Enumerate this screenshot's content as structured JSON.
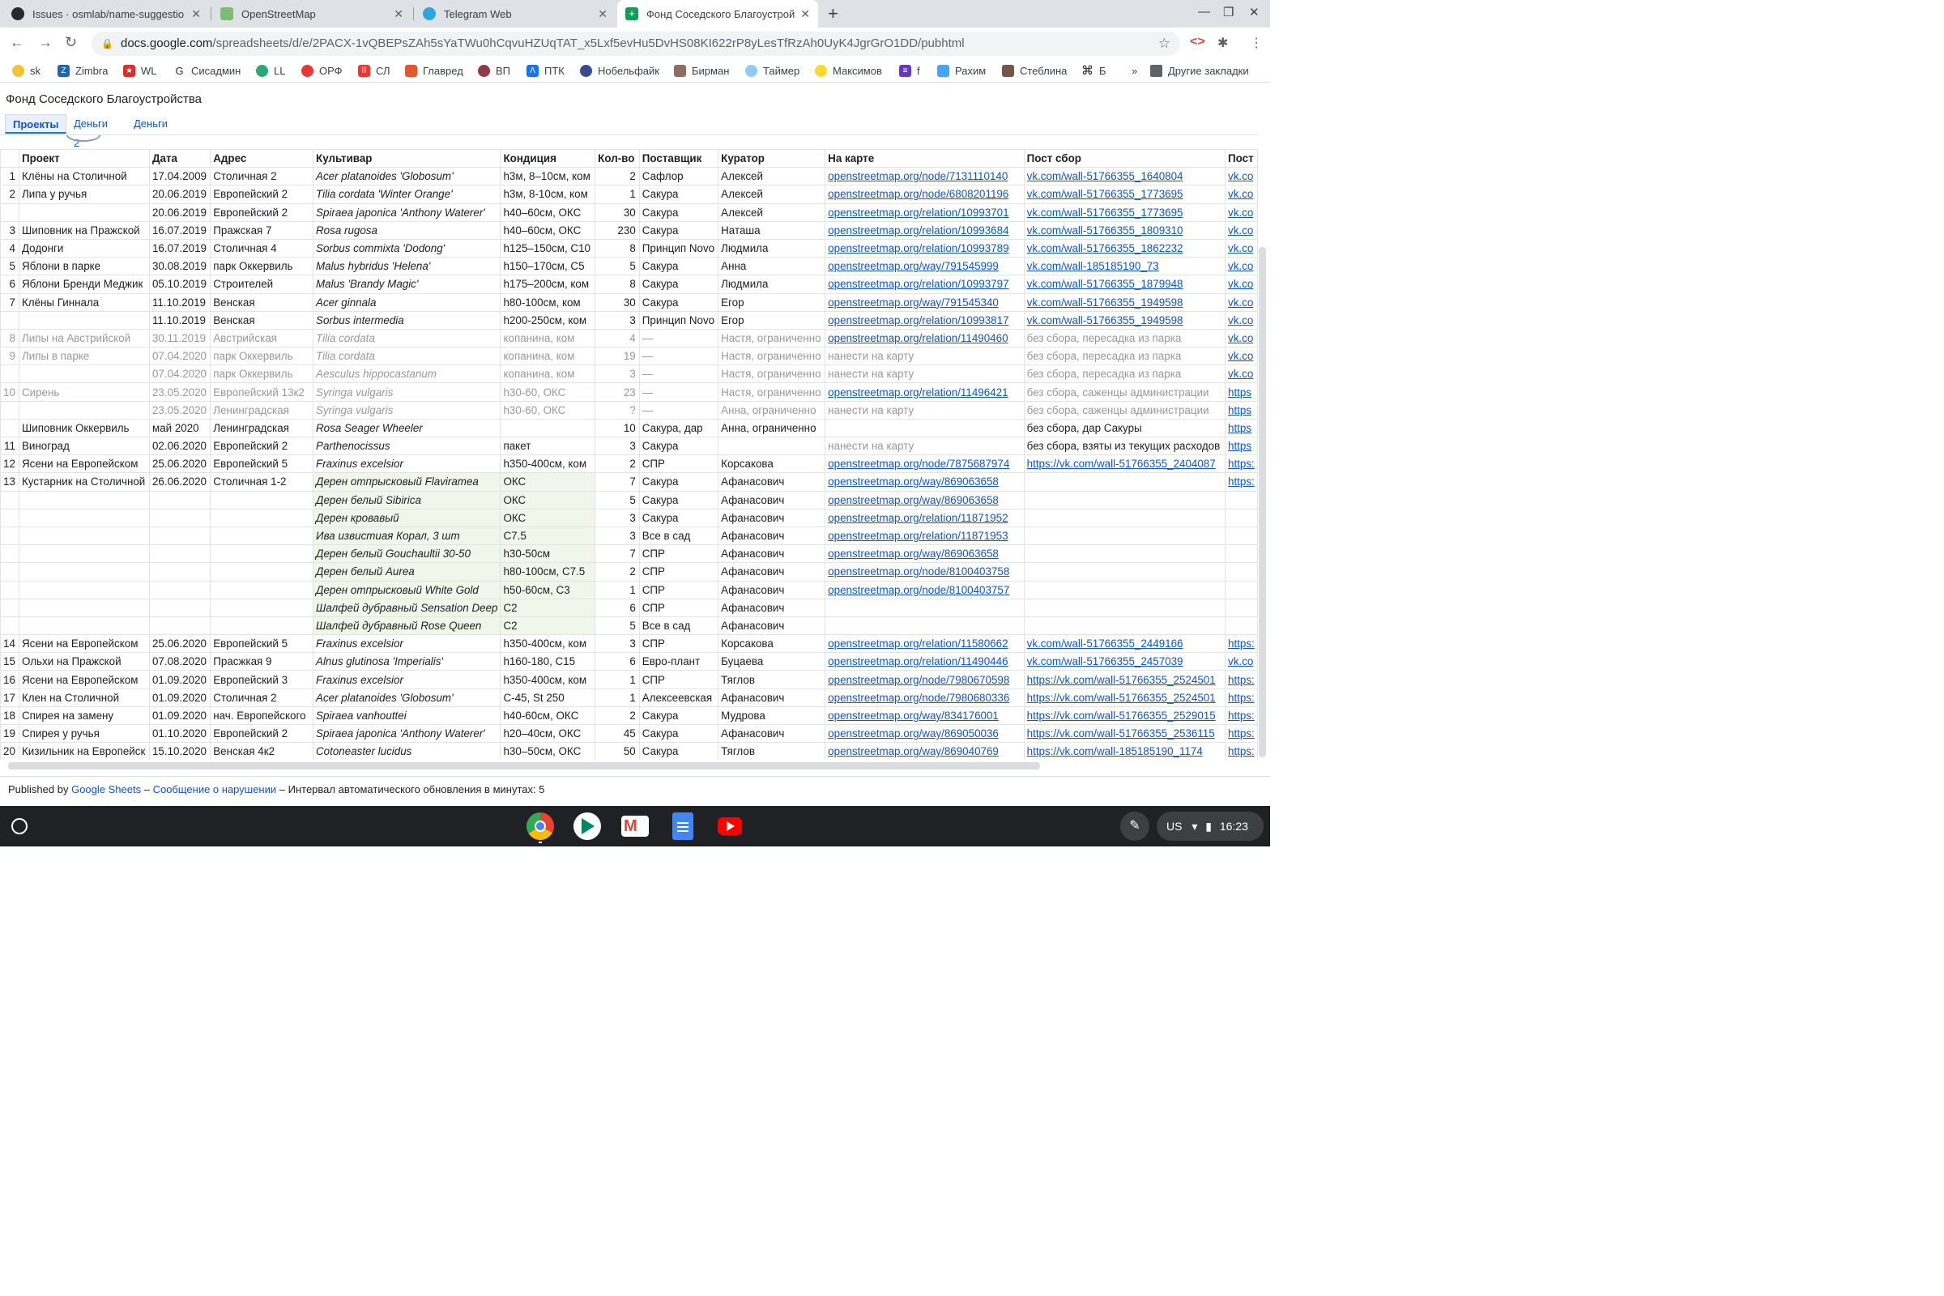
{
  "browser": {
    "tabs": [
      {
        "title": "Issues · osmlab/name-suggestio",
        "icon": "github-icon",
        "active": false
      },
      {
        "title": "OpenStreetMap",
        "icon": "osm-icon",
        "active": false
      },
      {
        "title": "Telegram Web",
        "icon": "telegram-icon",
        "active": false
      },
      {
        "title": "Фонд Соседского Благоустрой",
        "icon": "sheets-icon",
        "active": true
      }
    ],
    "new_tab": "+",
    "url_host": "docs.google.com",
    "url_path": "/spreadsheets/d/e/2PACX-1vQBEPsZAh5sYaTWu0hCqvuHZUqTAT_x5Lxf5evHu5DvHS08KI622rP8yLesTfRzAh0UyK4JgrGrO1DD/pubhtml",
    "bookmarks": [
      "sk",
      "Zimbra",
      "WL",
      "Сисадмин",
      "LL",
      "ОРФ",
      "СЛ",
      "Главред",
      "ВП",
      "ПТК",
      "Нобельфайк",
      "Бирман",
      "Таймер",
      "Максимов",
      "f",
      "Рахим",
      "Стеблина",
      "Б"
    ],
    "bookmarks_more": "»",
    "other_bookmarks": "Другие закладки"
  },
  "doc": {
    "title": "Фонд Соседского Благоустройства",
    "sheet_tabs": [
      "Проекты",
      "Деньги 2",
      "Деньги"
    ]
  },
  "table": {
    "headers": [
      "",
      "Проект",
      "Дата",
      "Адрес",
      "Культивар",
      "Кондиция",
      "Кол-во",
      "Поставщик",
      "Куратор",
      "На карте",
      "Пост сбор",
      "Пост"
    ],
    "rows": [
      [
        "1",
        "Клёны на Столичной",
        "17.04.2009",
        "Столичная 2",
        "Acer platanoides 'Globosum'",
        "h3м, 8–10см, ком",
        "2",
        "Сафлор",
        "Алексей",
        "openstreetmap.org/node/7131110140",
        "vk.com/wall-51766355_1640804",
        "vk.co"
      ],
      [
        "2",
        "Липа у ручья",
        "20.06.2019",
        "Европейский 2",
        "Tilia cordata 'Winter Orange'",
        "h3м, 8-10см, ком",
        "1",
        "Сакура",
        "Алексей",
        "openstreetmap.org/node/6808201196",
        "vk.com/wall-51766355_1773695",
        "vk.co"
      ],
      [
        "",
        "",
        "20.06.2019",
        "Европейский 2",
        "Spiraea japonica 'Anthony Waterer'",
        "h40–60см, ОКС",
        "30",
        "Сакура",
        "Алексей",
        "openstreetmap.org/relation/10993701",
        "vk.com/wall-51766355_1773695",
        "vk.co"
      ],
      [
        "3",
        "Шиповник на Пражской",
        "16.07.2019",
        "Пражская 7",
        "Rosa rugosa",
        "h40–60см, ОКС",
        "230",
        "Сакура",
        "Наташа",
        "openstreetmap.org/relation/10993684",
        "vk.com/wall-51766355_1809310",
        "vk.co"
      ],
      [
        "4",
        "Додонги",
        "16.07.2019",
        "Столичная 4",
        "Sorbus commixta 'Dodong'",
        "h125–150см, C10",
        "8",
        "Принцип Novo",
        "Людмила",
        "openstreetmap.org/relation/10993789",
        "vk.com/wall-51766355_1862232",
        "vk.co"
      ],
      [
        "5",
        "Яблони в парке",
        "30.08.2019",
        "парк Оккервиль",
        "Malus hybridus 'Helena'",
        "h150–170см, C5",
        "5",
        "Сакура",
        "Анна",
        "openstreetmap.org/way/791545999",
        "vk.com/wall-185185190_73",
        "vk.co"
      ],
      [
        "6",
        "Яблони Бренди Меджик",
        "05.10.2019",
        "Строителей",
        "Malus 'Brandy Magic'",
        "h175–200см, ком",
        "8",
        "Сакура",
        "Людмила",
        "openstreetmap.org/relation/10993797",
        "vk.com/wall-51766355_1879948",
        "vk.co"
      ],
      [
        "7",
        "Клёны Гиннала",
        "11.10.2019",
        "Венская",
        "Acer ginnala",
        "h80-100см, ком",
        "30",
        "Сакура",
        "Егор",
        "openstreetmap.org/way/791545340",
        "vk.com/wall-51766355_1949598",
        "vk.co"
      ],
      [
        "",
        "",
        "11.10.2019",
        "Венская",
        "Sorbus intermedia",
        "h200-250см, ком",
        "3",
        "Принцип Novo",
        "Егор",
        "openstreetmap.org/relation/10993817",
        "vk.com/wall-51766355_1949598",
        "vk.co"
      ],
      [
        "8",
        "Липы на Австрийской",
        "30.11.2019",
        "Австрийская",
        "Tilia cordata",
        "копанина, ком",
        "4",
        "—",
        "Настя, ограниченно",
        "openstreetmap.org/relation/11490460",
        "без сбора, пересадка из парка",
        "vk.co"
      ],
      [
        "9",
        "Липы в парке",
        "07.04.2020",
        "парк Оккервиль",
        "Tilia cordata",
        "копанина, ком",
        "19",
        "—",
        "Настя, ограниченно",
        "нанести на карту",
        "без сбора, пересадка из парка",
        "vk.co"
      ],
      [
        "",
        "",
        "07.04.2020",
        "парк Оккервиль",
        "Aesculus hippocastanum",
        "копанина, ком",
        "3",
        "—",
        "Настя, ограниченно",
        "нанести на карту",
        "без сбора, пересадка из парка",
        "vk.co"
      ],
      [
        "10",
        "Сирень",
        "23.05.2020",
        "Европейский 13к2",
        "Syringa vulgaris",
        "h30-60, ОКС",
        "23",
        "—",
        "Настя, ограниченно",
        "openstreetmap.org/relation/11496421",
        "без сбора, саженцы администрации",
        "https"
      ],
      [
        "",
        "",
        "23.05.2020",
        "Ленинградская",
        "Syringa vulgaris",
        "h30-60, ОКС",
        "?",
        "—",
        "Анна, ограниченно",
        "нанести на карту",
        "без сбора, саженцы администрации",
        "https"
      ],
      [
        "",
        "Шиповник Оккервиль",
        "май 2020",
        "Ленинградская",
        "Rosa Seager Wheeler",
        "",
        "10",
        "Сакура, дар",
        "Анна, ограниченно",
        "",
        "без сбора, дар Сакуры",
        "https"
      ],
      [
        "11",
        "Виноград",
        "02.06.2020",
        "Европейский 2",
        "Parthenocissus",
        "пакет",
        "3",
        "Сакура",
        "",
        "нанести на карту",
        "без сбора, взяты из текущих расходов",
        "https"
      ],
      [
        "12",
        "Ясени на Европейском",
        "25.06.2020",
        "Европейский 5",
        "Fraxinus excelsior",
        "h350-400см, ком",
        "2",
        "СПР",
        "Корсакова",
        "openstreetmap.org/node/7875687974",
        "https://vk.com/wall-51766355_2404087",
        "https:"
      ],
      [
        "13",
        "Кустарник на Столичной",
        "26.06.2020",
        "Столичная 1-2",
        "Дерен отпрысковый Flaviramea",
        "ОКС",
        "7",
        "Сакура",
        "Афанасович",
        "openstreetmap.org/way/869063658",
        "",
        "https:"
      ],
      [
        "",
        "",
        "",
        "",
        "Дерен белый Sibirica",
        "ОКС",
        "5",
        "Сакура",
        "Афанасович",
        "openstreetmap.org/way/869063658",
        "",
        ""
      ],
      [
        "",
        "",
        "",
        "",
        "Дерен кровавый",
        "ОКС",
        "3",
        "Сакура",
        "Афанасович",
        "openstreetmap.org/relation/11871952",
        "",
        ""
      ],
      [
        "",
        "",
        "",
        "",
        "Ива извистиая Корал, 3 шт",
        "С7.5",
        "3",
        "Все в сад",
        "Афанасович",
        "openstreetmap.org/relation/11871953",
        "",
        ""
      ],
      [
        "",
        "",
        "",
        "",
        "Дерен белый Gouchaultii 30-50",
        "h30-50см",
        "7",
        "СПР",
        "Афанасович",
        "openstreetmap.org/way/869063658",
        "",
        ""
      ],
      [
        "",
        "",
        "",
        "",
        "Дерен белый Aurea",
        "h80-100см, C7.5",
        "2",
        "СПР",
        "Афанасович",
        "openstreetmap.org/node/8100403758",
        "",
        ""
      ],
      [
        "",
        "",
        "",
        "",
        "Дерен отпрысковый White Gold",
        "h50-60см, C3",
        "1",
        "СПР",
        "Афанасович",
        "openstreetmap.org/node/8100403757",
        "",
        ""
      ],
      [
        "",
        "",
        "",
        "",
        "Шалфей дубравный Sensation Deep",
        "C2",
        "6",
        "СПР",
        "Афанасович",
        "",
        "",
        ""
      ],
      [
        "",
        "",
        "",
        "",
        "Шалфей дубравный Rose Queen",
        "C2",
        "5",
        "Все в сад",
        "Афанасович",
        "",
        "",
        ""
      ],
      [
        "14",
        "Ясени на Европейском",
        "25.06.2020",
        "Европейский 5",
        "Fraxinus excelsior",
        "h350-400см, ком",
        "3",
        "СПР",
        "Корсакова",
        "openstreetmap.org/relation/11580662",
        "vk.com/wall-51766355_2449166",
        "https:"
      ],
      [
        "15",
        "Ольхи на Пражской",
        "07.08.2020",
        "Праcжкая 9",
        "Alnus glutinosa 'Imperialis'",
        "h160-180, C15",
        "6",
        "Евро-плант",
        "Буцаева",
        "openstreetmap.org/relation/11490446",
        "vk.com/wall-51766355_2457039",
        "vk.co"
      ],
      [
        "16",
        "Ясени на Европейском",
        "01.09.2020",
        "Европейский 3",
        "Fraxinus excelsior",
        "h350-400см, ком",
        "1",
        "СПР",
        "Тяглов",
        "openstreetmap.org/node/7980670598",
        "https://vk.com/wall-51766355_2524501",
        "https:"
      ],
      [
        "17",
        "Клен на Столичной",
        "01.09.2020",
        "Столичная 2",
        "Acer platanoides 'Globosum'",
        "C-45, St 250",
        "1",
        "Алексеевская",
        "Афанасович",
        "openstreetmap.org/node/7980680336",
        "https://vk.com/wall-51766355_2524501",
        "https:"
      ],
      [
        "18",
        "Спирея на замену",
        "01.09.2020",
        "нач. Европейского",
        "Spiraea vanhouttei",
        "h40-60см, ОКС",
        "2",
        "Сакура",
        "Мудрова",
        "openstreetmap.org/way/834176001",
        "https://vk.com/wall-51766355_2529015",
        "https:"
      ],
      [
        "19",
        "Спирея у ручья",
        "01.10.2020",
        "Европейский 2",
        "Spiraea japonica 'Anthony Waterer'",
        "h20–40см, ОКС",
        "45",
        "Сакура",
        "Афанасович",
        "openstreetmap.org/way/869050036",
        "https://vk.com/wall-51766355_2536115",
        "https:"
      ],
      [
        "20",
        "Кизильник на Европейск",
        "15.10.2020",
        "Венская 4к2",
        "Cotoneaster lucidus",
        "h30–50см, ОКС",
        "50",
        "Сакура",
        "Тяглов",
        "openstreetmap.org/way/869040769",
        "https://vk.com/wall-185185190_1174",
        "https:"
      ]
    ],
    "grey_rows": [
      9,
      10,
      11,
      12,
      13
    ],
    "green_rows": [
      17,
      18,
      19,
      20,
      21,
      22,
      23,
      24,
      25
    ]
  },
  "footer": {
    "published_by": "Published by",
    "google_sheets": "Google Sheets",
    "dash": "–",
    "report": "Сообщение о нарушении",
    "interval": "Интервал автоматического обновления в минутах: 5"
  },
  "shelf": {
    "apps": [
      "chrome-icon",
      "play-store-icon",
      "gmail-icon",
      "docs-icon",
      "youtube-icon"
    ],
    "ime": "US",
    "time": "16:23"
  }
}
